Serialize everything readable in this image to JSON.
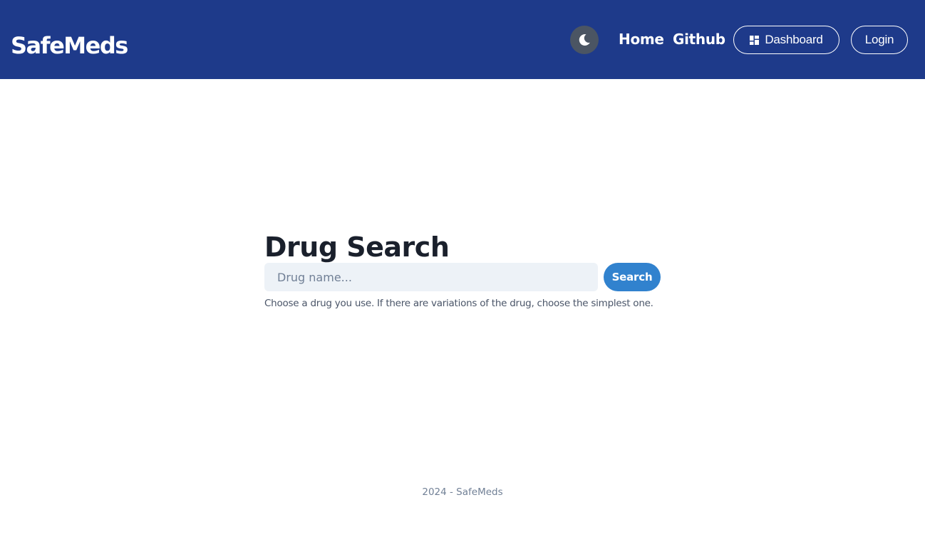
{
  "header": {
    "brand": "SafeMeds",
    "theme_toggle_icon": "moon-icon",
    "nav": {
      "home": "Home",
      "github": "Github"
    },
    "dashboard_label": "Dashboard",
    "dashboard_icon": "dashboard-grid-icon",
    "login_label": "Login"
  },
  "main": {
    "title": "Drug Search",
    "search": {
      "placeholder": "Drug name...",
      "value": "",
      "button_label": "Search"
    },
    "helper_text": "Choose a drug you use. If there are variations of the drug, choose the simplest one."
  },
  "footer": {
    "text": "2024 - SafeMeds"
  },
  "colors": {
    "navbar_bg": "#1e3a8a",
    "toggle_bg": "#4b5563",
    "accent": "#3182ce",
    "input_bg": "#edf2f7",
    "title_text": "#1a202c"
  }
}
